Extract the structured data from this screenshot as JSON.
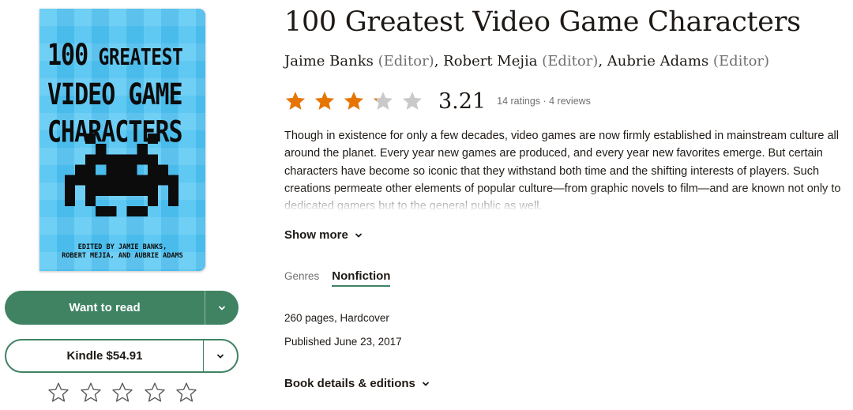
{
  "cover": {
    "title_line1_num": "100",
    "title_line1_word": "GREATEST",
    "title_line2": "VIDEO GAME",
    "title_line3": "CHARACTERS",
    "credit_line1": "EDITED BY JAMIE BANKS,",
    "credit_line2": "ROBERT MEJIA, AND AUBRIE ADAMS"
  },
  "actions": {
    "want_to_read": "Want to read",
    "kindle": "Kindle $54.91"
  },
  "user_rating": {
    "max_stars": 5,
    "value": 0
  },
  "book": {
    "title": "100 Greatest Video Game Characters",
    "authors": [
      {
        "name": "Jaime Banks",
        "role": "(Editor)",
        "sep": ", "
      },
      {
        "name": "Robert Mejia",
        "role": "(Editor)",
        "sep": ", "
      },
      {
        "name": "Aubrie Adams",
        "role": "(Editor)",
        "sep": ""
      }
    ],
    "average_rating": "3.21",
    "rating_value": 3.21,
    "ratings_meta": "14 ratings · 4 reviews",
    "description": "Though in existence for only a few decades, video games are now firmly established in mainstream culture all around the planet. Every year new games are produced, and every year new favorites emerge. But certain characters have become so iconic that they withstand both time and the shifting interests of players. Such creations permeate other elements of popular culture—from graphic novels to film—and are known not only to dedicated gamers but to the general public as well.",
    "show_more": "Show more",
    "genres_label": "Genres",
    "genres": [
      "Nonfiction"
    ],
    "pages_format": "260 pages, Hardcover",
    "published": "Published June 23, 2017",
    "book_details": "Book details & editions"
  },
  "colors": {
    "brand_green": "#3f8363",
    "star_filled": "#e87400",
    "star_empty": "#c9c9c9",
    "cover_blue": "#4ec3f2"
  },
  "icons": {
    "star": "star-icon",
    "chevron": "chevron-down-icon",
    "rate_star": "star-outline-icon"
  }
}
